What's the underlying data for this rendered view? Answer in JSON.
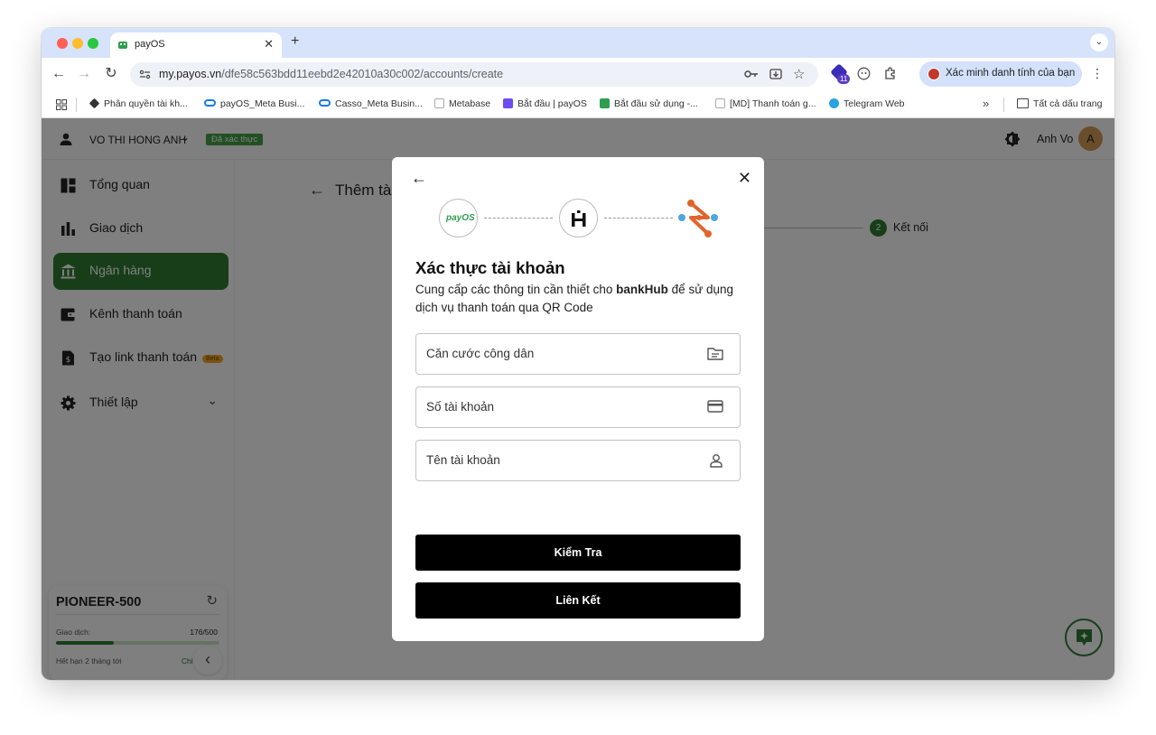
{
  "browser": {
    "tab_title": "payOS",
    "url_host": "my.payos.vn",
    "url_path": "/dfe58c563bdd11eebd2e42010a30c002/accounts/create",
    "extension_badge": "11",
    "profile_label": "Xác minh danh tính của bạn",
    "bookmarks": [
      {
        "label": "Phân quyền tài kh...",
        "icon": "stack-icon"
      },
      {
        "label": "payOS_Meta Busi...",
        "icon": "meta-icon"
      },
      {
        "label": "Casso_Meta Busin...",
        "icon": "meta-icon"
      },
      {
        "label": "Metabase",
        "icon": "gmail-icon"
      },
      {
        "label": "Bắt đầu | payOS",
        "icon": "purple-square-icon"
      },
      {
        "label": "Bắt đầu sử dụng -...",
        "icon": "payos-icon"
      },
      {
        "label": "[MD] Thanh toán g...",
        "icon": "gmail-icon"
      },
      {
        "label": "Telegram Web",
        "icon": "telegram-icon"
      }
    ],
    "all_bookmarks": "Tất cả dấu trang"
  },
  "topbar": {
    "user_name": "VO THI HONG ANH",
    "verified_badge": "Đã xác thực",
    "account_name": "Anh Vo",
    "avatar_letter": "A"
  },
  "sidebar": {
    "items": [
      {
        "label": "Tổng quan",
        "icon": "dashboard-icon"
      },
      {
        "label": "Giao dịch",
        "icon": "bar-chart-icon"
      },
      {
        "label": "Ngân hàng",
        "icon": "bank-icon"
      },
      {
        "label": "Kênh thanh toán",
        "icon": "wallet-icon"
      },
      {
        "label": "Tạo link thanh toán",
        "icon": "invoice-icon",
        "badge": "Beta"
      },
      {
        "label": "Thiết lập",
        "icon": "gear-icon"
      }
    ],
    "active_index": 2,
    "plan": {
      "name": "PIONEER-500",
      "usage_label": "Giao dịch:",
      "usage_value": "176/500",
      "usage_fraction": 0.352,
      "expiry": "Hết hạn 2 tháng tới",
      "details_link": "Chi tiết gói"
    }
  },
  "main": {
    "page_title": "Thêm tài",
    "step_number": "2",
    "step_label": "Kết nối"
  },
  "modal": {
    "logos": {
      "payos": "payOS"
    },
    "title": "Xác thực tài khoản",
    "desc_prefix": "Cung cấp các thông tin cần thiết cho ",
    "desc_brand": "bankHub",
    "desc_suffix": " để sử dụng dịch vụ thanh toán qua QR Code",
    "fields": [
      {
        "placeholder": "Căn cước công dân",
        "icon": "id-card-icon"
      },
      {
        "placeholder": "Số tài khoản",
        "icon": "credit-card-icon"
      },
      {
        "placeholder": "Tên tài khoản",
        "icon": "person-icon"
      }
    ],
    "check_button": "Kiểm Tra",
    "link_button": "Liên Kết"
  },
  "colors": {
    "primary": "#2e7d32",
    "overlay": "rgba(0,0,0,0.5)",
    "tab_strip": "#d7e3fb"
  }
}
